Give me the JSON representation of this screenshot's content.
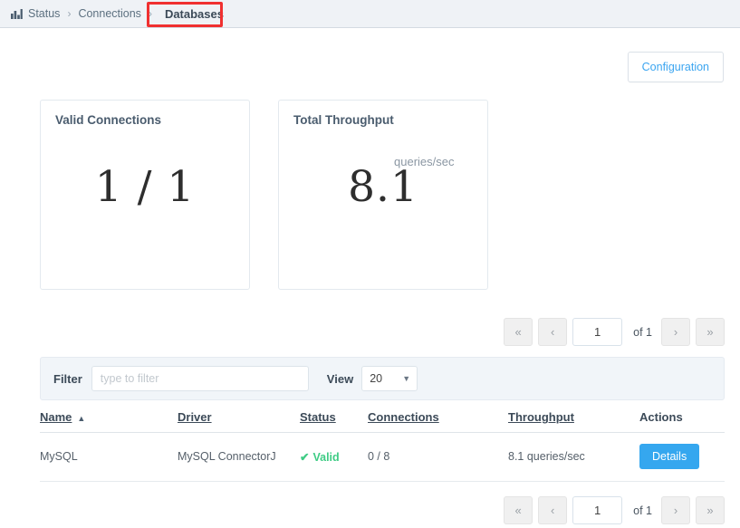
{
  "breadcrumb": {
    "icon": "bar-chart-icon",
    "items": [
      {
        "label": "Status",
        "current": false
      },
      {
        "label": "Connections",
        "current": false
      },
      {
        "label": "Databases",
        "current": true
      }
    ],
    "separator": "›",
    "highlight_color": "#f03030"
  },
  "toolbar": {
    "configuration_label": "Configuration",
    "configuration_color": "#3ba5f0"
  },
  "cards": [
    {
      "title": "Valid Connections",
      "value": "1 / 1",
      "unit": ""
    },
    {
      "title": "Total Throughput",
      "value": "8.1",
      "unit": "queries/sec"
    }
  ],
  "pagination": {
    "first_label": "«",
    "prev_label": "‹",
    "next_label": "›",
    "last_label": "»",
    "page_value": "1",
    "of_label": "of 1"
  },
  "filterbar": {
    "filter_label": "Filter",
    "filter_value": "",
    "filter_placeholder": "type to filter",
    "view_label": "View",
    "view_value": "20",
    "view_options": [
      "20"
    ],
    "caret": "▼"
  },
  "table": {
    "columns": [
      {
        "label": "Name",
        "sortable": true,
        "sorted": "asc"
      },
      {
        "label": "Driver",
        "sortable": true,
        "sorted": ""
      },
      {
        "label": "Status",
        "sortable": true,
        "sorted": ""
      },
      {
        "label": "Connections",
        "sortable": true,
        "sorted": ""
      },
      {
        "label": "Throughput",
        "sortable": true,
        "sorted": ""
      },
      {
        "label": "Actions",
        "sortable": false,
        "sorted": ""
      }
    ],
    "sort_caret": "▲",
    "rows": [
      {
        "name": "MySQL",
        "driver": "MySQL ConnectorJ",
        "status": "Valid",
        "status_check": "✔",
        "status_color": "#3fcc85",
        "connections": "0 / 8",
        "throughput": "8.1 queries/sec",
        "action_label": "Details"
      }
    ]
  }
}
